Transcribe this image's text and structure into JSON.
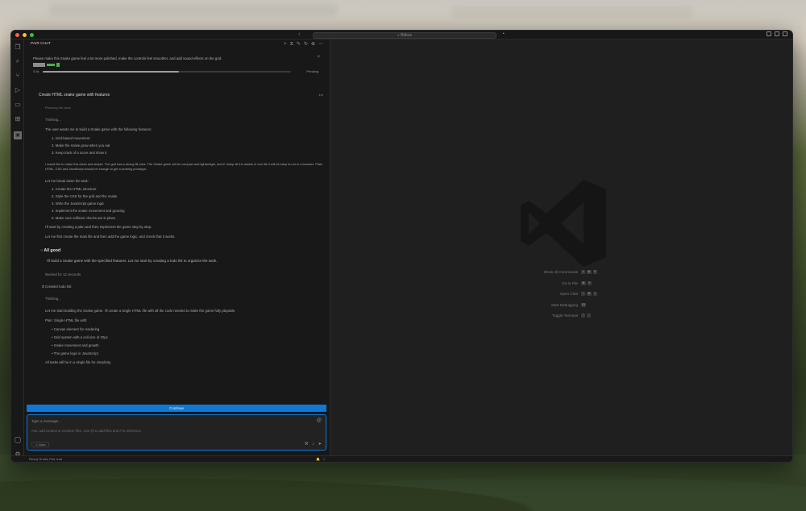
{
  "titlebar": {
    "search_text": "Bitbux",
    "nav_arrows": "‹ ›"
  },
  "chat": {
    "header_title": "PAIR CHAT",
    "prompt": "Please make this Snake game feel a lot more polished, make the controls feel smoother, and add sound effects on the grid.",
    "progress": {
      "label": "0.5s",
      "fraction": 0.55,
      "status": "Pending"
    },
    "task_title": "Create HTML snake game with features",
    "task_time": "1m",
    "thinking_chip": "Planning the work",
    "thinking_label": "Thinking...",
    "agent_intro": "The user wants me to build a Snake game with the following features:",
    "features": [
      "1. Grid-based movement",
      "2. Make the snake grow when you eat",
      "3. Keep track of a score and show it"
    ],
    "agent_para": "I would like to make this clean and simple. The grid has a strong fill color. The Snake game will be compact and lightweight, and if I keep all the assets in one file it will be easy to run in a browser. Plain HTML, CSS and JavaScript should be enough to get a working prototype.",
    "plan_intro": "Let me break down the task:",
    "plan_steps": [
      "1. Create the HTML structure",
      "2. Style the CSS for the grid and the snake",
      "3. Write the JavaScript game logic",
      "4. Implement the snake movement and growing",
      "5. Make sure collision checks are in place"
    ],
    "plan_note": "I'll start by creating a plan and then implement the game step by step.",
    "plan_note2": "Let me first create the main file and then add the game logic, and check that it works.",
    "section_head": "All good",
    "section_body": "I'll build a Snake game with the specified features. Let me start by creating a todo list to organize the work.",
    "file_link": "Worked for 12 seconds",
    "ran_line": "$ Created todo list",
    "thinking2": "Thinking...",
    "agent2": "Let me start building the Snake game. I'll create a single HTML file with all the code needed to make the game fully playable.",
    "agent3": "Plan: Single HTML file with:",
    "bullets": [
      "Canvas element for rendering",
      "Grid system with a cell size of 20px",
      "Snake movement and growth",
      "The game logic in JavaScript"
    ],
    "agent4": "All tasks will be in a single file for simplicity.",
    "continue_label": "Continue",
    "input_placeholder": "Type a message...",
    "input_hint": "Ask, add context or mention files. Use @ to add files and # to reference.",
    "model_label": "Auto",
    "status_left": "Ready  Snake  Pair chat"
  },
  "shortcuts": [
    {
      "label": "Show All Commands",
      "keys": [
        "⇧",
        "⌘",
        "P"
      ]
    },
    {
      "label": "Go to File",
      "keys": [
        "⌘",
        "P"
      ]
    },
    {
      "label": "Open Chat",
      "keys": [
        "⌃",
        "⌘",
        "I"
      ]
    },
    {
      "label": "Start Debugging",
      "keys": [
        "F5"
      ]
    },
    {
      "label": "Toggle Terminal",
      "keys": [
        "⌃",
        "`"
      ]
    }
  ]
}
